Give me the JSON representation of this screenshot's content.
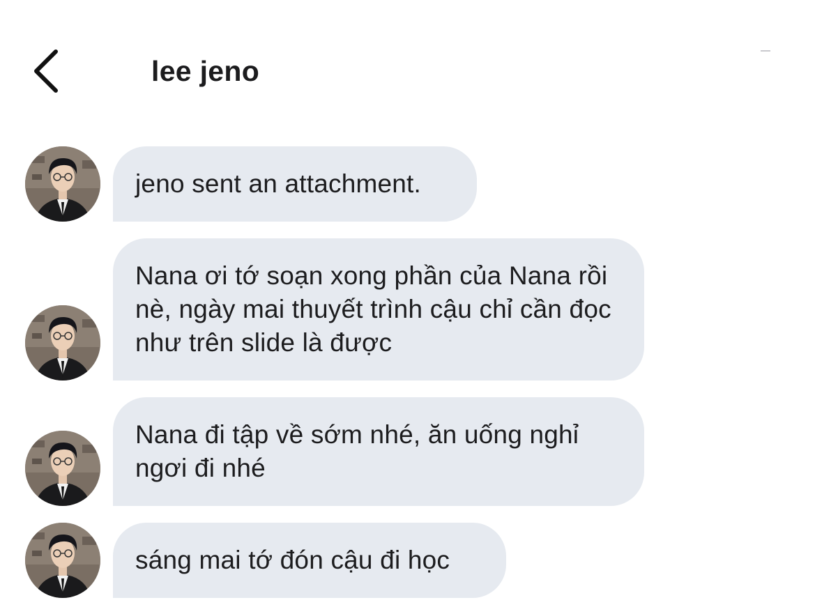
{
  "header": {
    "title": "lee jeno",
    "back_icon": "chevron-left-icon"
  },
  "messages": [
    {
      "text": "jeno sent an attachment."
    },
    {
      "text": "Nana ơi tớ soạn xong phần của Nana rồi nè, ngày mai thuyết trình cậu chỉ cần đọc như trên slide là được"
    },
    {
      "text": "Nana đi tập về sớm nhé, ăn uống nghỉ ngơi đi nhé"
    },
    {
      "text": "sáng mai tớ đón cậu đi học"
    }
  ],
  "colors": {
    "bubble_bg": "#e6eaf0",
    "text": "#1c1c1e",
    "background": "#ffffff"
  }
}
